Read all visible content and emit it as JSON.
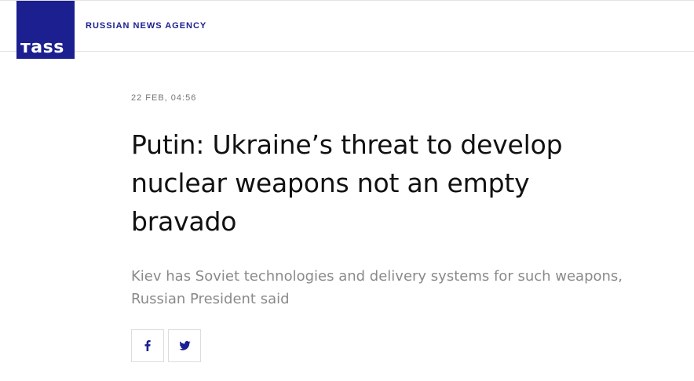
{
  "header": {
    "logo_text": "тass",
    "agency_label": "RUSSIAN NEWS AGENCY"
  },
  "article": {
    "date": "22 FEB, 04:56",
    "headline": "Putin: Ukraine’s threat to develop nuclear weapons not an empty bravado",
    "lead": "Kiev has Soviet technologies and delivery systems for such weapons, Russian President said"
  },
  "share": {
    "buttons": [
      {
        "icon": "facebook-icon"
      },
      {
        "icon": "twitter-icon"
      }
    ]
  },
  "colors": {
    "brand": "#1c1f8f",
    "headline": "#111111",
    "lead": "#8a8a8a",
    "date": "#757575"
  }
}
